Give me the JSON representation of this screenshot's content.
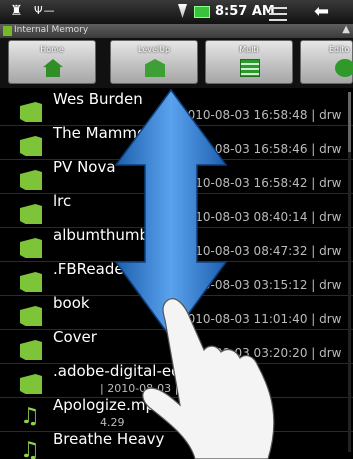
{
  "status_bar": {
    "time": "8:57 AM"
  },
  "path_bar": {
    "label": "Internal Memory"
  },
  "toolbar": {
    "home": "Home",
    "levelup": "LevelUp",
    "multi": "Multi",
    "edit": "Edito"
  },
  "files": [
    {
      "name": "Wes Burden",
      "meta": "2010-08-03 16:58:48 | drw",
      "type": "folder"
    },
    {
      "name": "The Mammoth Files",
      "meta": "2010-08-03 16:58:46 | drw",
      "type": "folder"
    },
    {
      "name": "PV Nova",
      "meta": "2010-08-03 16:58:42 | drw",
      "type": "folder"
    },
    {
      "name": "lrc",
      "meta": "2010-08-03 08:40:14 | drw",
      "type": "folder"
    },
    {
      "name": "albumthumbs",
      "meta": "2010-08-03 08:47:32 | drw",
      "type": "folder"
    },
    {
      "name": ".FBReader",
      "meta": "2010-08-03 03:15:12 | drw",
      "type": "folder"
    },
    {
      "name": "book",
      "meta": "2010-08-03 11:01:40 | drw",
      "type": "folder"
    },
    {
      "name": "Cover",
      "meta": "2010-08-03 03:20:20 | drw",
      "type": "folder"
    },
    {
      "name": ".adobe-digital-editions",
      "meta": "| 2010-08-03 | drw",
      "type": "folder"
    },
    {
      "name": "Apologize.mp3",
      "meta": "4.29",
      "type": "music"
    },
    {
      "name": "Breathe Heavy",
      "meta": "",
      "type": "music"
    }
  ],
  "colors": {
    "folder_green": "#7ec438",
    "arrow_blue": "#3a86d8"
  },
  "icons": [
    "home-icon",
    "usb-icon",
    "wifi-icon",
    "battery-icon",
    "menu-icon",
    "back-icon",
    "folder-icon",
    "music-icon",
    "scroll-arrow-icon",
    "hand-icon"
  ]
}
